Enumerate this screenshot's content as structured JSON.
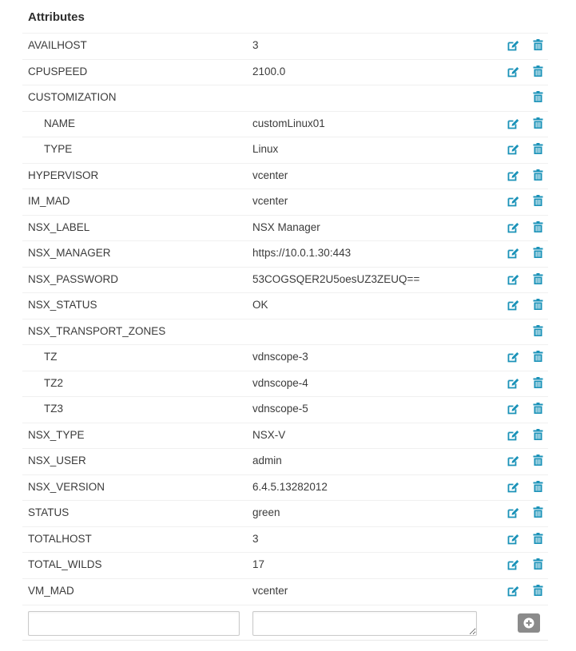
{
  "title": "Attributes",
  "accent_color": "#1a92b8",
  "icons": {
    "edit": "edit-icon",
    "delete": "trash-icon",
    "add": "plus-circle-icon"
  },
  "attributes": [
    {
      "key": "AVAILHOST",
      "value": "3",
      "child": false,
      "editable": true
    },
    {
      "key": "CPUSPEED",
      "value": "2100.0",
      "child": false,
      "editable": true
    },
    {
      "key": "CUSTOMIZATION",
      "value": "",
      "child": false,
      "editable": false
    },
    {
      "key": "NAME",
      "value": "customLinux01",
      "child": true,
      "editable": true
    },
    {
      "key": "TYPE",
      "value": "Linux",
      "child": true,
      "editable": true
    },
    {
      "key": "HYPERVISOR",
      "value": "vcenter",
      "child": false,
      "editable": true
    },
    {
      "key": "IM_MAD",
      "value": "vcenter",
      "child": false,
      "editable": true
    },
    {
      "key": "NSX_LABEL",
      "value": "NSX Manager",
      "child": false,
      "editable": true
    },
    {
      "key": "NSX_MANAGER",
      "value": "https://10.0.1.30:443",
      "child": false,
      "editable": true
    },
    {
      "key": "NSX_PASSWORD",
      "value": "53COGSQER2U5oesUZ3ZEUQ==",
      "child": false,
      "editable": true
    },
    {
      "key": "NSX_STATUS",
      "value": "OK",
      "child": false,
      "editable": true
    },
    {
      "key": "NSX_TRANSPORT_ZONES",
      "value": "",
      "child": false,
      "editable": false
    },
    {
      "key": "TZ",
      "value": "vdnscope-3",
      "child": true,
      "editable": true
    },
    {
      "key": "TZ2",
      "value": "vdnscope-4",
      "child": true,
      "editable": true
    },
    {
      "key": "TZ3",
      "value": "vdnscope-5",
      "child": true,
      "editable": true
    },
    {
      "key": "NSX_TYPE",
      "value": "NSX-V",
      "child": false,
      "editable": true
    },
    {
      "key": "NSX_USER",
      "value": "admin",
      "child": false,
      "editable": true
    },
    {
      "key": "NSX_VERSION",
      "value": "6.4.5.13282012",
      "child": false,
      "editable": true
    },
    {
      "key": "STATUS",
      "value": "green",
      "child": false,
      "editable": true
    },
    {
      "key": "TOTALHOST",
      "value": "3",
      "child": false,
      "editable": true
    },
    {
      "key": "TOTAL_WILDS",
      "value": "17",
      "child": false,
      "editable": true
    },
    {
      "key": "VM_MAD",
      "value": "vcenter",
      "child": false,
      "editable": true
    }
  ],
  "new_attribute": {
    "key_value": "",
    "value_value": ""
  }
}
